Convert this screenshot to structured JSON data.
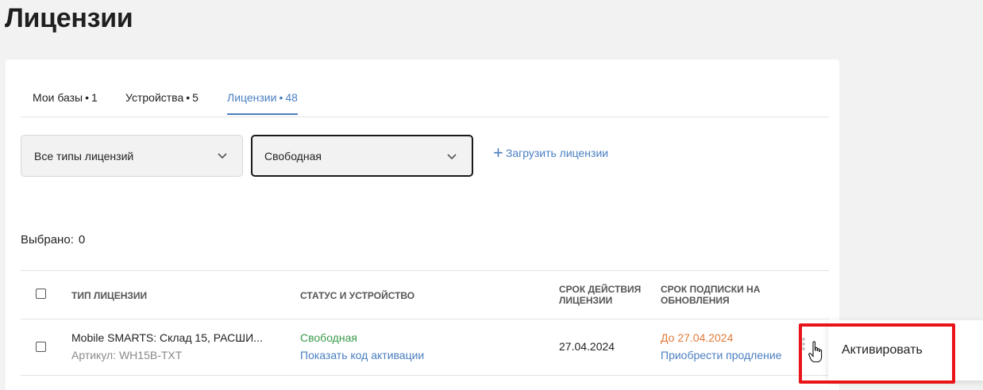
{
  "page": {
    "title": "Лицензии"
  },
  "tabs": [
    {
      "label": "Мои базы",
      "count": "1"
    },
    {
      "label": "Устройства",
      "count": "5"
    },
    {
      "label": "Лицензии",
      "count": "48"
    }
  ],
  "tab_separator": "•",
  "filters": {
    "license_types": {
      "value": "Все типы лицензий"
    },
    "status": {
      "value": "Свободная"
    },
    "upload_label": "Загрузить лицензии"
  },
  "selection": {
    "label": "Выбрано:",
    "count": "0"
  },
  "table": {
    "columns": {
      "type": "ТИП ЛИЦЕНЗИИ",
      "status": "СТАТУС И УСТРОЙСТВО",
      "expiry_line1": "СРОК ДЕЙСТВИЯ",
      "expiry_line2": "ЛИЦЕНЗИИ",
      "subscription_line1": "СРОК ПОДПИСКИ НА",
      "subscription_line2": "ОБНОВЛЕНИЯ"
    },
    "rows": [
      {
        "name": "Mobile SMARTS: Склад 15, РАСШИ...",
        "article": "Артикул: WH15B-TXT",
        "status": "Свободная",
        "activation_link": "Показать код активации",
        "expiry": "27.04.2024",
        "subscription": "До 27.04.2024",
        "renew_link": "Приобрести продление"
      }
    ]
  },
  "context_menu": {
    "items": [
      "Активировать"
    ]
  },
  "colors": {
    "accent": "#4a7fc1",
    "status_free": "#3a9a4a",
    "subscription": "#e07a3a",
    "highlight": "#e8141a"
  }
}
